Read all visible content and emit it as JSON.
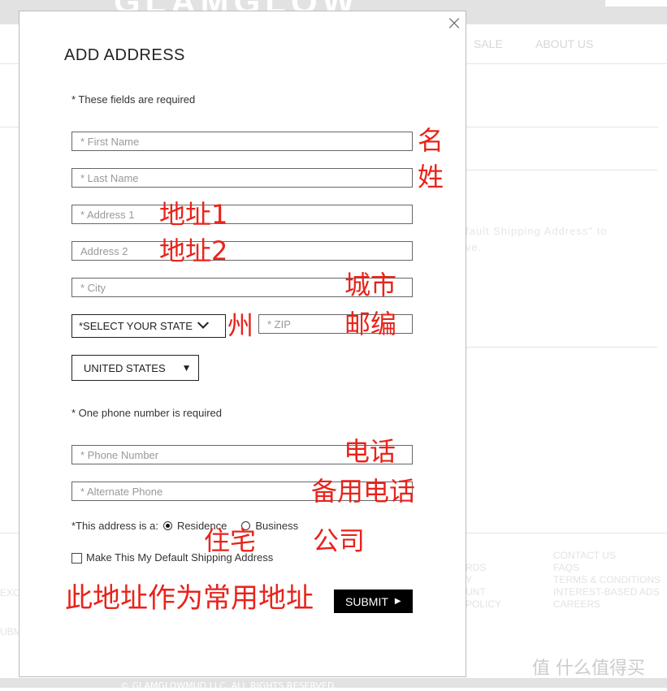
{
  "background": {
    "logo": "GLAMGLOW",
    "nav": [
      "SALE",
      "ABOUT US"
    ],
    "notice_fragment": [
      "fault Shipping Address\" to",
      "ve."
    ],
    "footer_left_fragments": [
      "EXC",
      "UBM"
    ],
    "footer_col1": [
      "RDS",
      "Y",
      "UNT",
      "POLICY"
    ],
    "footer_col2": [
      "CONTACT US",
      "FAQS",
      "TERMS & CONDITIONS",
      "INTEREST-BASED ADS",
      "CAREERS"
    ],
    "copyright": "© GLAMGLOWMUD LLC. ALL RIGHTS RESERVED.",
    "watermark": "值 什么值得买"
  },
  "modal": {
    "title": "ADD ADDRESS",
    "close_icon": "×",
    "required_note": "* These fields are required",
    "fields": {
      "first_name": "* First Name",
      "last_name": "* Last Name",
      "address1": "* Address 1",
      "address2": "Address 2",
      "city": "* City",
      "zip": "* ZIP",
      "phone": "* Phone Number",
      "alt_phone": "* Alternate Phone"
    },
    "state_select": "*SELECT YOUR STATE",
    "country_select": "UNITED STATES",
    "phone_note": "* One phone number is required",
    "address_type_label": "*This address is a:",
    "address_types": [
      "Residence",
      "Business"
    ],
    "address_type_selected": "Residence",
    "default_checkbox_label": "Make This My Default Shipping Address",
    "default_checked": false,
    "submit": "SUBMIT"
  },
  "annotations": {
    "first_name": "名",
    "last_name": "姓",
    "address1": "地址1",
    "address2": "地址2",
    "city": "城市",
    "state": "州",
    "zip": "邮编",
    "phone": "电话",
    "alt_phone": "备用电话",
    "residence": "住宅",
    "business": "公司",
    "default": "此地址作为常用地址",
    "color": "#e8231b"
  }
}
